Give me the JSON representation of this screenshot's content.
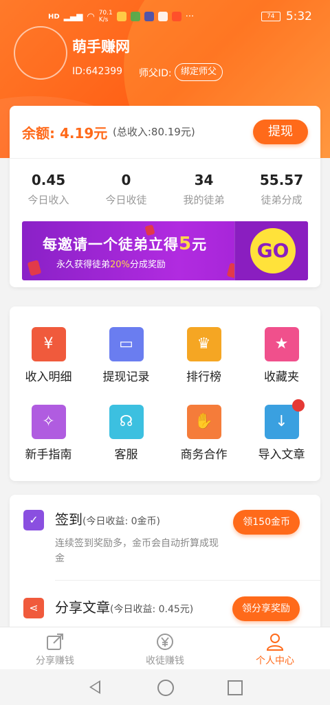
{
  "status": {
    "speed": "70.1\nK/s",
    "time": "5:32",
    "battery": "74"
  },
  "header": {
    "app_name": "萌手赚网",
    "user_id": "ID:642399",
    "master_label": "师父ID:",
    "bind_label": "绑定师父"
  },
  "balance": {
    "label": "余额: 4.19元",
    "total": "(总收入:80.19元)",
    "withdraw": "提现"
  },
  "stats": [
    {
      "value": "0.45",
      "label": "今日收入"
    },
    {
      "value": "0",
      "label": "今日收徒"
    },
    {
      "value": "34",
      "label": "我的徒弟"
    },
    {
      "value": "55.57",
      "label": "徒弟分成"
    }
  ],
  "banner": {
    "title_a": "每邀请一个徒弟立得",
    "title_b": "5",
    "title_c": "元",
    "sub_a": "永久获得徒弟",
    "sub_b": "20%",
    "sub_c": "分成奖励",
    "go": "GO"
  },
  "menu": [
    {
      "label": "收入明细",
      "icon": "ledger-icon",
      "color": "#f05a3c",
      "glyph": "¥"
    },
    {
      "label": "提现记录",
      "icon": "wallet-icon",
      "color": "#6a7df0",
      "glyph": "▭"
    },
    {
      "label": "排行榜",
      "icon": "trophy-icon",
      "color": "#f5a623",
      "glyph": "♛"
    },
    {
      "label": "收藏夹",
      "icon": "star-icon",
      "color": "#f0508c",
      "glyph": "★"
    },
    {
      "label": "新手指南",
      "icon": "compass-icon",
      "color": "#b05ce0",
      "glyph": "✧"
    },
    {
      "label": "客服",
      "icon": "headset-icon",
      "color": "#3cc0e0",
      "glyph": "☊"
    },
    {
      "label": "商务合作",
      "icon": "handshake-icon",
      "color": "#f57c3a",
      "glyph": "✋"
    },
    {
      "label": "导入文章",
      "icon": "import-doc-icon",
      "color": "#3aa0e0",
      "glyph": "↓"
    }
  ],
  "tasks": {
    "signin_title": "签到",
    "signin_sub": "(今日收益: 0金币)",
    "signin_desc": "连续签到奖励多，金币会自动折算成现金",
    "signin_btn": "领150金币",
    "share_title": "分享文章",
    "share_sub": "(今日收益: 0.45元)",
    "share_btn": "领分享奖励"
  },
  "tabs": [
    {
      "label": "分享赚钱",
      "icon": "share-out-icon"
    },
    {
      "label": "收徒赚钱",
      "icon": "yen-circle-icon"
    },
    {
      "label": "个人中心",
      "icon": "person-icon"
    }
  ],
  "colors": {
    "accent": "#ff6a1a",
    "banner": "#8a21c7",
    "go": "#ffe23a"
  }
}
